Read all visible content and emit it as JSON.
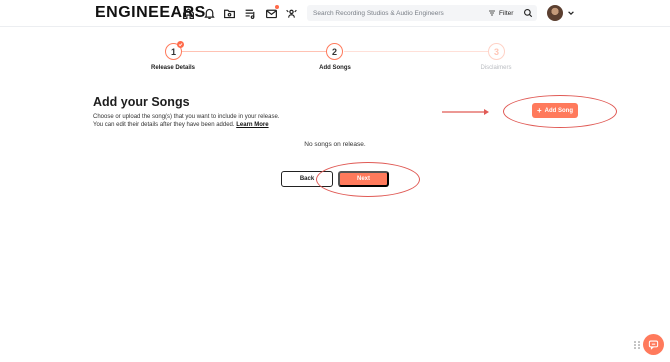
{
  "header": {
    "logo_text": "ENGINEEARS",
    "nav_icons": [
      "home-icon",
      "bell-icon",
      "folder-icon",
      "playlist-icon",
      "mail-icon",
      "community-icon"
    ],
    "search_placeholder": "Search Recording Studios & Audio Engineers",
    "filter_label": "Filter"
  },
  "stepper": {
    "steps": [
      {
        "number": "1",
        "label": "Release Details",
        "state": "done"
      },
      {
        "number": "2",
        "label": "Add Songs",
        "state": "active"
      },
      {
        "number": "3",
        "label": "Disclaimers",
        "state": "todo"
      }
    ]
  },
  "main": {
    "title": "Add your Songs",
    "description_line1": "Choose or upload the song(s) that you want to include in your release.",
    "description_line2": "You can edit their details after they have been added.",
    "learn_more": "Learn More",
    "add_song_label": "Add Song",
    "empty_text": "No songs on release.",
    "back_label": "Back",
    "next_label": "Next"
  },
  "colors": {
    "accent": "#ff7a5c",
    "annotation": "#e05a55"
  }
}
